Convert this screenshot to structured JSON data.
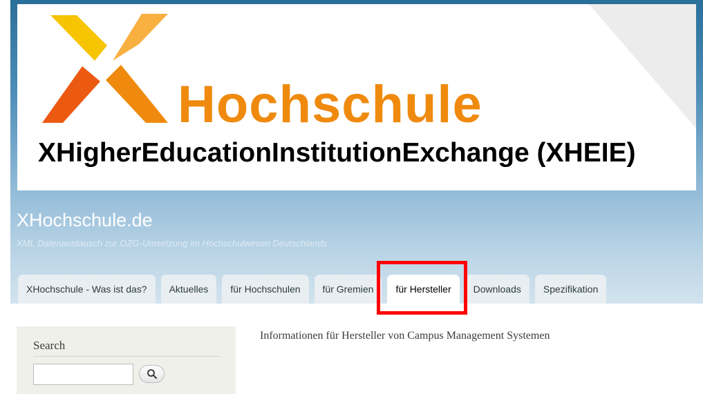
{
  "banner": {
    "wordmark": "Hochschule",
    "subtitle": "XHigherEducationInstitutionExchange (XHEIE)"
  },
  "site": {
    "name": "XHochschule.de",
    "slogan": "XML Datenaustausch zur OZG-Umsetzung im Hochschulwesen Deutschlands"
  },
  "nav": {
    "tabs": [
      {
        "label": "XHochschule - Was ist das?"
      },
      {
        "label": "Aktuelles"
      },
      {
        "label": "für Hochschulen"
      },
      {
        "label": "für Gremien"
      },
      {
        "label": "für Hersteller",
        "active": true
      },
      {
        "label": "Downloads"
      },
      {
        "label": "Spezifikation"
      }
    ]
  },
  "sidebar": {
    "search_title": "Search",
    "search_value": "",
    "search_icon": "search-icon"
  },
  "main": {
    "text": "Informationen für Hersteller von Campus Management Systemen"
  },
  "colors": {
    "accent_orange": "#ef8a0e",
    "highlight": "#ff0000",
    "header_blue": "#2a6f9a"
  }
}
